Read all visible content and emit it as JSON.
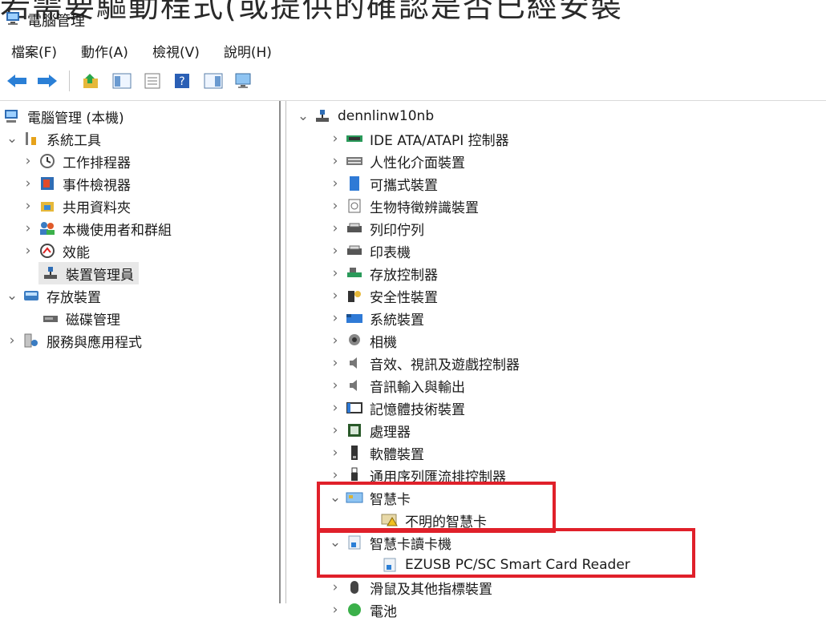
{
  "overlay_heading": "若需要驅動程式(或提供的確認是否已經安裝",
  "window": {
    "title": "電腦管理"
  },
  "menu": [
    "檔案(F)",
    "動作(A)",
    "檢視(V)",
    "說明(H)"
  ],
  "left_tree": [
    {
      "label": "電腦管理 (本機)",
      "icon": "computer-management-icon"
    },
    {
      "label": "系統工具",
      "icon": "system-tools-icon"
    },
    {
      "label": "工作排程器",
      "icon": "task-scheduler-icon"
    },
    {
      "label": "事件檢視器",
      "icon": "event-viewer-icon"
    },
    {
      "label": "共用資料夾",
      "icon": "shared-folder-icon"
    },
    {
      "label": "本機使用者和群組",
      "icon": "users-groups-icon"
    },
    {
      "label": "效能",
      "icon": "performance-icon"
    },
    {
      "label": "裝置管理員",
      "icon": "device-manager-icon"
    },
    {
      "label": "存放裝置",
      "icon": "storage-icon"
    },
    {
      "label": "磁碟管理",
      "icon": "disk-management-icon"
    },
    {
      "label": "服務與應用程式",
      "icon": "services-apps-icon"
    }
  ],
  "right_tree": {
    "root": "dennlinw10nb",
    "categories": [
      "IDE ATA/ATAPI 控制器",
      "人性化介面裝置",
      "可攜式裝置",
      "生物特徵辨識裝置",
      "列印佇列",
      "印表機",
      "存放控制器",
      "安全性裝置",
      "系統裝置",
      "相機",
      "音效、視訊及遊戲控制器",
      "音訊輸入與輸出",
      "記憶體技術裝置",
      "處理器",
      "軟體裝置",
      "通用序列匯流排控制器",
      "智慧卡",
      "不明的智慧卡",
      "智慧卡讀卡機",
      "EZUSB PC/SC Smart Card Reader",
      "滑鼠及其他指標裝置",
      "電池"
    ]
  },
  "colors": {
    "highlight": "#e0202a",
    "selection": "#e8e8e8"
  }
}
